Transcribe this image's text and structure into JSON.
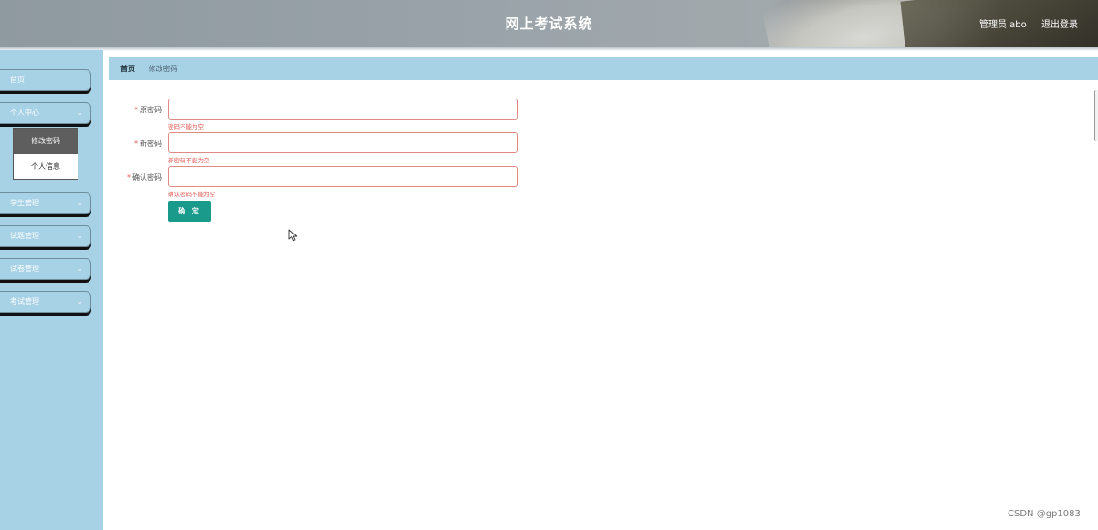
{
  "header": {
    "title": "网上考试系统",
    "user": "管理员 abo",
    "logout_label": "退出登录"
  },
  "sidebar": {
    "items": [
      {
        "label": "首页",
        "has_chevron": false
      },
      {
        "label": "个人中心",
        "has_chevron": true,
        "expanded": true
      },
      {
        "label": "学生管理",
        "has_chevron": true
      },
      {
        "label": "试题管理",
        "has_chevron": true
      },
      {
        "label": "试卷管理",
        "has_chevron": true
      },
      {
        "label": "考试管理",
        "has_chevron": true
      }
    ],
    "submenu": [
      {
        "label": "修改密码",
        "active": true
      },
      {
        "label": "个人信息",
        "active": false
      }
    ],
    "chevron_icon": "chevron-down-icon"
  },
  "breadcrumb": {
    "home": "首页",
    "current": "修改密码"
  },
  "form": {
    "fields": [
      {
        "label": "原密码",
        "required_mark": "*",
        "value": "",
        "error": "密码不能为空"
      },
      {
        "label": "新密码",
        "required_mark": "*",
        "value": "",
        "error": "新密码不能为空"
      },
      {
        "label": "确认密码",
        "required_mark": "*",
        "value": "",
        "error": "确认密码不能为空"
      }
    ],
    "submit_label": "确 定"
  },
  "watermark": "CSDN @gp1083",
  "colors": {
    "sidebar_bg": "#a7d2e5",
    "accent_button": "#1a9a8a",
    "error": "#e05a55",
    "submenu_active": "#5e5e5e"
  }
}
